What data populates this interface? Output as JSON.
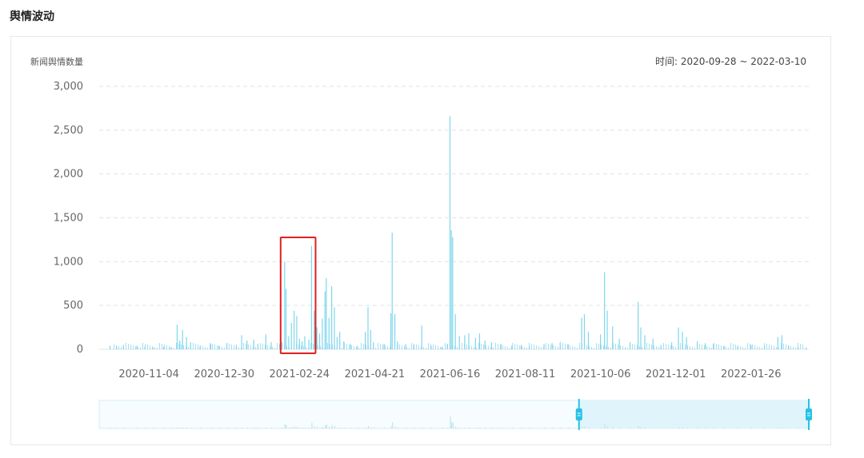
{
  "page": {
    "section_title": "舆情波动",
    "y_axis_title": "新闻舆情数量",
    "time_range_label": "时间: 2020-09-28 ~ 2022-03-10"
  },
  "colors": {
    "bar": "#7fd6ec",
    "grid": "#e3e3e3",
    "axis_text": "#666666",
    "highlight_box": "#e02020",
    "slider_fill": "#dff4fb",
    "slider_handle": "#27c1e6"
  },
  "chart_data": {
    "type": "bar",
    "xlabel": "",
    "ylabel": "新闻舆情数量",
    "x_range": [
      "2020-09-28",
      "2022-03-10"
    ],
    "x_ticks": [
      "2020-11-04",
      "2020-12-30",
      "2021-02-24",
      "2021-04-21",
      "2021-06-16",
      "2021-08-11",
      "2021-10-06",
      "2021-12-01",
      "2022-01-26"
    ],
    "ylim": [
      0,
      3000
    ],
    "y_ticks": [
      0,
      500,
      1000,
      1500,
      2000,
      2500,
      3000
    ],
    "y_tick_labels": [
      "0",
      "500",
      "1,000",
      "1,500",
      "2,000",
      "2,500",
      "3,000"
    ],
    "grid": true,
    "highlight_range": [
      "2021-02-10",
      "2021-03-08"
    ],
    "zoom_window": [
      "2021-09-20",
      "2022-03-10"
    ],
    "series": [
      {
        "values": [
          [
            "2020-10-06",
            40
          ],
          [
            "2020-10-11",
            30
          ],
          [
            "2020-10-16",
            50
          ],
          [
            "2020-10-26",
            40
          ],
          [
            "2020-11-01",
            30
          ],
          [
            "2020-11-07",
            20
          ],
          [
            "2020-11-15",
            30
          ],
          [
            "2020-11-20",
            20
          ],
          [
            "2020-11-25",
            280
          ],
          [
            "2020-11-27",
            100
          ],
          [
            "2020-11-29",
            220
          ],
          [
            "2020-12-02",
            140
          ],
          [
            "2020-12-05",
            80
          ],
          [
            "2020-12-12",
            30
          ],
          [
            "2020-12-20",
            60
          ],
          [
            "2020-12-26",
            40
          ],
          [
            "2021-01-01",
            70
          ],
          [
            "2021-01-08",
            50
          ],
          [
            "2021-01-12",
            160
          ],
          [
            "2021-01-16",
            100
          ],
          [
            "2021-01-21",
            110
          ],
          [
            "2021-01-24",
            60
          ],
          [
            "2021-01-30",
            170
          ],
          [
            "2021-02-03",
            80
          ],
          [
            "2021-02-11",
            80
          ],
          [
            "2021-02-13",
            1000
          ],
          [
            "2021-02-14",
            690
          ],
          [
            "2021-02-16",
            150
          ],
          [
            "2021-02-18",
            300
          ],
          [
            "2021-02-20",
            440
          ],
          [
            "2021-02-22",
            380
          ],
          [
            "2021-02-24",
            120
          ],
          [
            "2021-02-26",
            90
          ],
          [
            "2021-02-28",
            150
          ],
          [
            "2021-03-03",
            110
          ],
          [
            "2021-03-05",
            1180
          ],
          [
            "2021-03-07",
            440
          ],
          [
            "2021-03-09",
            250
          ],
          [
            "2021-03-11",
            180
          ],
          [
            "2021-03-13",
            350
          ],
          [
            "2021-03-15",
            660
          ],
          [
            "2021-03-16",
            810
          ],
          [
            "2021-03-18",
            360
          ],
          [
            "2021-03-20",
            720
          ],
          [
            "2021-03-22",
            480
          ],
          [
            "2021-03-24",
            140
          ],
          [
            "2021-03-26",
            200
          ],
          [
            "2021-03-29",
            90
          ],
          [
            "2021-04-03",
            60
          ],
          [
            "2021-04-08",
            40
          ],
          [
            "2021-04-14",
            200
          ],
          [
            "2021-04-16",
            480
          ],
          [
            "2021-04-18",
            220
          ],
          [
            "2021-04-20",
            80
          ],
          [
            "2021-04-28",
            60
          ],
          [
            "2021-05-03",
            410
          ],
          [
            "2021-05-04",
            1330
          ],
          [
            "2021-05-06",
            400
          ],
          [
            "2021-05-08",
            90
          ],
          [
            "2021-05-14",
            60
          ],
          [
            "2021-05-20",
            50
          ],
          [
            "2021-05-26",
            270
          ],
          [
            "2021-06-02",
            40
          ],
          [
            "2021-06-10",
            30
          ],
          [
            "2021-06-14",
            60
          ],
          [
            "2021-06-16",
            2660
          ],
          [
            "2021-06-17",
            1360
          ],
          [
            "2021-06-18",
            1280
          ],
          [
            "2021-06-20",
            400
          ],
          [
            "2021-06-23",
            150
          ],
          [
            "2021-06-27",
            160
          ],
          [
            "2021-06-30",
            180
          ],
          [
            "2021-07-05",
            130
          ],
          [
            "2021-07-08",
            180
          ],
          [
            "2021-07-12",
            100
          ],
          [
            "2021-07-17",
            80
          ],
          [
            "2021-07-24",
            60
          ],
          [
            "2021-08-01",
            40
          ],
          [
            "2021-08-08",
            50
          ],
          [
            "2021-08-14",
            40
          ],
          [
            "2021-08-25",
            60
          ],
          [
            "2021-08-31",
            70
          ],
          [
            "2021-09-06",
            80
          ],
          [
            "2021-09-12",
            60
          ],
          [
            "2021-09-22",
            360
          ],
          [
            "2021-09-24",
            400
          ],
          [
            "2021-09-27",
            200
          ],
          [
            "2021-10-06",
            170
          ],
          [
            "2021-10-09",
            880
          ],
          [
            "2021-10-11",
            440
          ],
          [
            "2021-10-15",
            260
          ],
          [
            "2021-10-20",
            120
          ],
          [
            "2021-10-28",
            80
          ],
          [
            "2021-11-03",
            540
          ],
          [
            "2021-11-05",
            250
          ],
          [
            "2021-11-08",
            160
          ],
          [
            "2021-11-14",
            120
          ],
          [
            "2021-11-20",
            50
          ],
          [
            "2021-11-28",
            80
          ],
          [
            "2021-12-03",
            250
          ],
          [
            "2021-12-06",
            200
          ],
          [
            "2021-12-09",
            140
          ],
          [
            "2021-12-17",
            90
          ],
          [
            "2021-12-23",
            70
          ],
          [
            "2021-12-29",
            60
          ],
          [
            "2022-01-06",
            40
          ],
          [
            "2022-01-16",
            30
          ],
          [
            "2022-01-26",
            50
          ],
          [
            "2022-02-05",
            40
          ],
          [
            "2022-02-15",
            140
          ],
          [
            "2022-02-18",
            160
          ],
          [
            "2022-02-23",
            40
          ],
          [
            "2022-03-02",
            30
          ],
          [
            "2022-03-08",
            20
          ]
        ]
      }
    ]
  }
}
